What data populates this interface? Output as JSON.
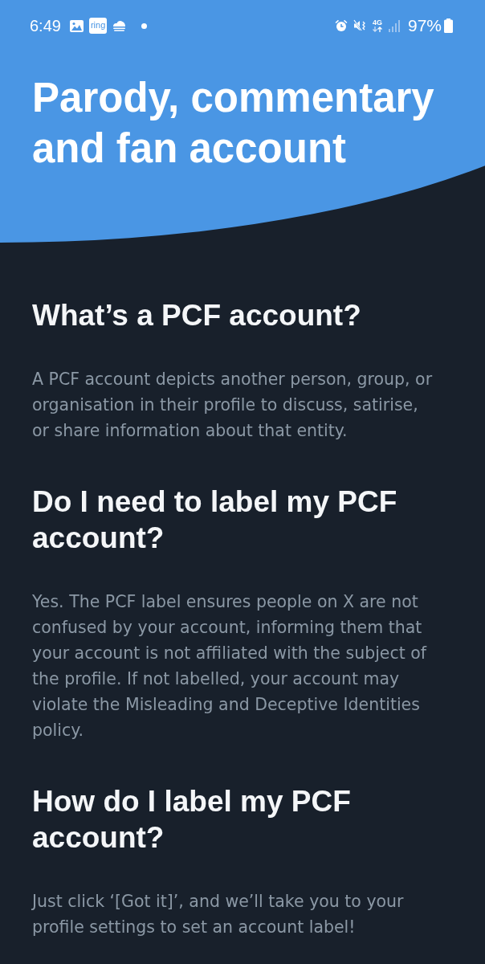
{
  "status_bar": {
    "time": "6:49",
    "notification_badge": "ring",
    "network_type": "4G",
    "battery": "97%"
  },
  "header": {
    "title": "Parody, commentary and fan account"
  },
  "sections": [
    {
      "heading": "What’s a PCF account?",
      "body": "A PCF account depicts another person, group, or organisation in their profile to discuss, satirise, or share information about that entity."
    },
    {
      "heading": "Do I need to label my PCF account?",
      "body": "Yes. The PCF label ensures people on X are not confused by your account, informing them that your account is not affiliated with the subject of the profile. If not labelled, your account may violate the Misleading and Deceptive Identities policy."
    },
    {
      "heading": "How do I label my PCF account?",
      "body": "Just click ‘[Got it]’, and we’ll take you to your profile settings to set an account label!"
    }
  ]
}
